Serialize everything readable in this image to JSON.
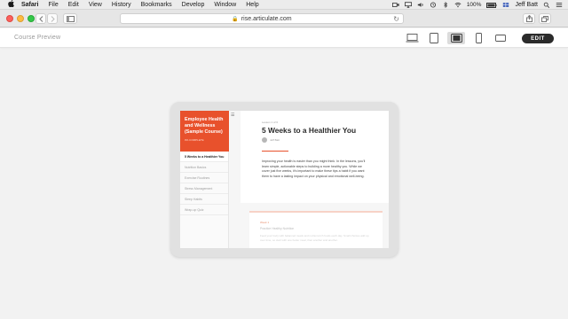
{
  "menubar": {
    "app": "Safari",
    "items": [
      "File",
      "Edit",
      "View",
      "History",
      "Bookmarks",
      "Develop",
      "Window",
      "Help"
    ],
    "battery": "100%",
    "user": "Jeff Batt"
  },
  "browser": {
    "url": "rise.articulate.com"
  },
  "rise": {
    "header_title": "Course Preview",
    "edit_label": "EDIT"
  },
  "course": {
    "title": "Employee Health and Wellness (Sample Course)",
    "progress": "0% COMPLETE",
    "lessons": [
      "5 Weeks to a Healthier You",
      "Nutrition Basics",
      "Exercise Routines",
      "Stress Management",
      "Sleep Habits",
      "Wrap-up Quiz"
    ],
    "lesson_kicker": "Lesson 1 of 6",
    "lesson_title": "5 Weeks to a Healthier You",
    "author": "Jeff Batt",
    "body": "Improving your health is easier than you might think. In the lessons, you'll learn simple, actionable steps to building a more healthy you. While we cover just five weeks, it's important to make these tips a habit if you want them to have a lasting impact on your physical and emotional well-being.",
    "card_kicker": "Week 1",
    "card_title": "Practice Healthy Nutrition",
    "card_body": "Feed your body with balanced meals and nutrient-rich foods each day. Small choices add up over time, so start with one better meal, then another and another."
  }
}
